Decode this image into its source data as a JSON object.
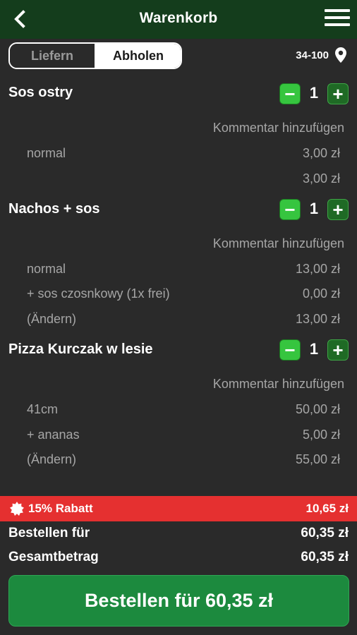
{
  "header": {
    "title": "Warenkorb",
    "back_icon": "chevron-left-icon",
    "menu_icon": "hamburger-menu-icon"
  },
  "delivery_toggle": {
    "deliver_label": "Liefern",
    "pickup_label": "Abholen",
    "selected": "Abholen"
  },
  "location": {
    "code": "34-100",
    "icon": "map-pin-icon"
  },
  "comment_label": "Kommentar hinzufügen",
  "items": [
    {
      "name": "Sos ostry",
      "qty": "1",
      "lines": [
        {
          "label": "normal",
          "price": "3,00 zł"
        },
        {
          "label": "",
          "price": "3,00 zł"
        }
      ]
    },
    {
      "name": "Nachos + sos",
      "qty": "1",
      "lines": [
        {
          "label": "normal",
          "price": "13,00 zł"
        },
        {
          "label": "+ sos czosnkowy (1x frei)",
          "price": "0,00 zł"
        },
        {
          "label": "(Ändern)",
          "price": "13,00 zł"
        }
      ]
    },
    {
      "name": "Pizza Kurczak w lesie",
      "qty": "1",
      "lines": [
        {
          "label": "41cm",
          "price": "50,00 zł"
        },
        {
          "label": "+ ananas",
          "price": "5,00 zł"
        },
        {
          "label": "(Ändern)",
          "price": "55,00 zł"
        }
      ]
    }
  ],
  "discount": {
    "label": "15% Rabatt",
    "value": "10,65 zł",
    "icon": "badge-icon"
  },
  "summary": {
    "order_for_label": "Bestellen für",
    "order_for_value": "60,35 zł",
    "total_label": "Gesamtbetrag",
    "total_value": "60,35 zł"
  },
  "order_button": "Bestellen für 60,35 zł",
  "colors": {
    "header_bg": "#143d1c",
    "background": "#2a2a2a",
    "accent_green": "#1c8a3e",
    "discount_red": "#e53030"
  }
}
